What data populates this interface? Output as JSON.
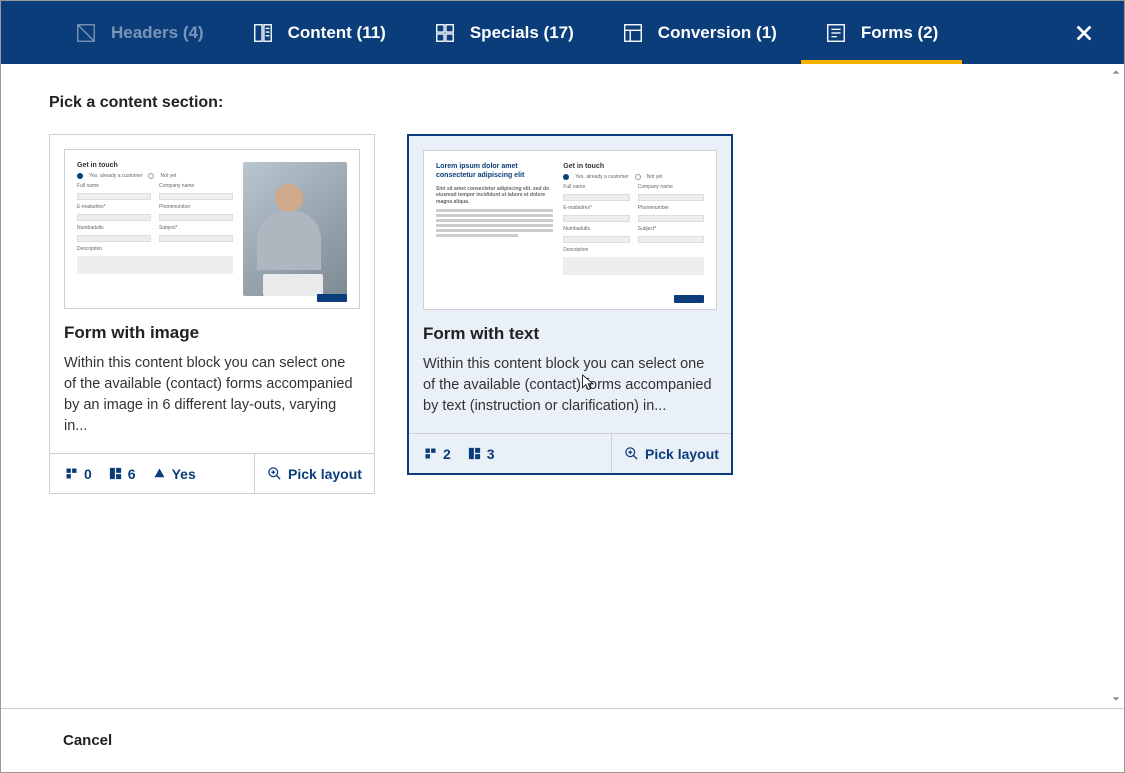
{
  "tabs": {
    "headers": "Headers (4)",
    "content": "Content (11)",
    "specials": "Specials (17)",
    "conversion": "Conversion (1)",
    "forms": "Forms (2)"
  },
  "body_title": "Pick a content section:",
  "cards": [
    {
      "title": "Form with image",
      "desc": "Within this content block you can select one of the available (contact) forms accompanied by an image in 6 different lay-outs, varying in...",
      "stat_a": "0",
      "stat_b": "6",
      "stat_c": "Yes",
      "pick": "Pick layout"
    },
    {
      "title": "Form with text",
      "desc": "Within this content block you can select one of the available (contact) forms accompanied by text (instruction or clarification) in...",
      "stat_a": "2",
      "stat_b": "3",
      "pick": "Pick layout"
    }
  ],
  "footer": {
    "cancel": "Cancel"
  },
  "preview": {
    "form_heading": "Get in touch",
    "radio_a": "Yes, already a customer",
    "radio_b": "Not yet",
    "labels": {
      "fullname": "Full name",
      "company": "Company name",
      "email": "E-mailadres*",
      "phone": "Phonenumber",
      "numadults": "Numbadults",
      "subject": "Subject*",
      "description": "Description"
    },
    "lorem_title": "Lorem ipsum dolor amet consectetur adipiscing elit",
    "lorem_sub": "Sint sit amet consectetur adipiscing elit. sed do eiusmod tempor incididunt ut labore et dolore magna aliqua."
  }
}
